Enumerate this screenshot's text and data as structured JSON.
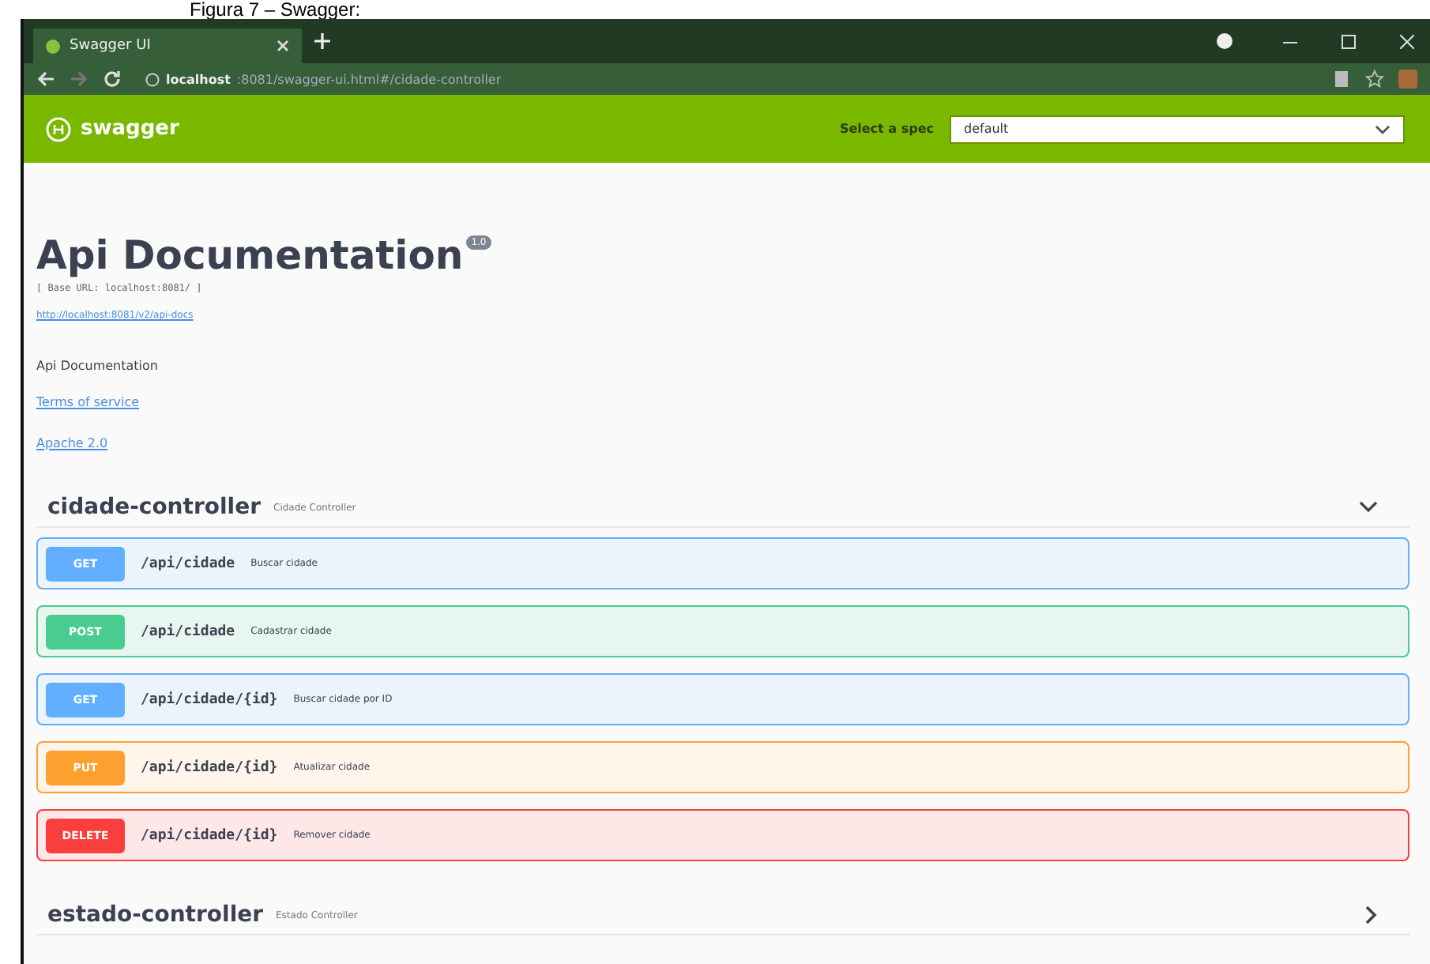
{
  "caption": "Figura 7 – Swagger:",
  "browser": {
    "tabs": [
      {
        "title": "Swagger UI",
        "selected": true
      }
    ],
    "url_host": "localhost",
    "url_rest": ":8081/swagger-ui.html#/cidade-controller"
  },
  "header": {
    "logo": "swagger",
    "spec_label": "Select a spec",
    "spec_value": "default"
  },
  "info": {
    "title": "Api Documentation",
    "version": "1.0",
    "base_url": "[ Base URL: localhost:8081/ ]",
    "docs_link": "http://localhost:8081/v2/api-docs",
    "description": "Api Documentation",
    "links": [
      "Terms of service",
      "Apache 2.0"
    ]
  },
  "sections": [
    {
      "name": "cidade-controller",
      "description": "Cidade Controller",
      "expanded": true,
      "operations": [
        {
          "kind": "get",
          "method": "GET",
          "path": "/api/cidade",
          "summary": "Buscar cidade"
        },
        {
          "kind": "post",
          "method": "POST",
          "path": "/api/cidade",
          "summary": "Cadastrar cidade"
        },
        {
          "kind": "get",
          "method": "GET",
          "path": "/api/cidade/{id}",
          "summary": "Buscar cidade por ID"
        },
        {
          "kind": "put",
          "method": "PUT",
          "path": "/api/cidade/{id}",
          "summary": "Atualizar cidade"
        },
        {
          "kind": "delete",
          "method": "DELETE",
          "path": "/api/cidade/{id}",
          "summary": "Remover cidade"
        }
      ]
    },
    {
      "name": "estado-controller",
      "description": "Estado Controller",
      "expanded": false
    }
  ]
}
